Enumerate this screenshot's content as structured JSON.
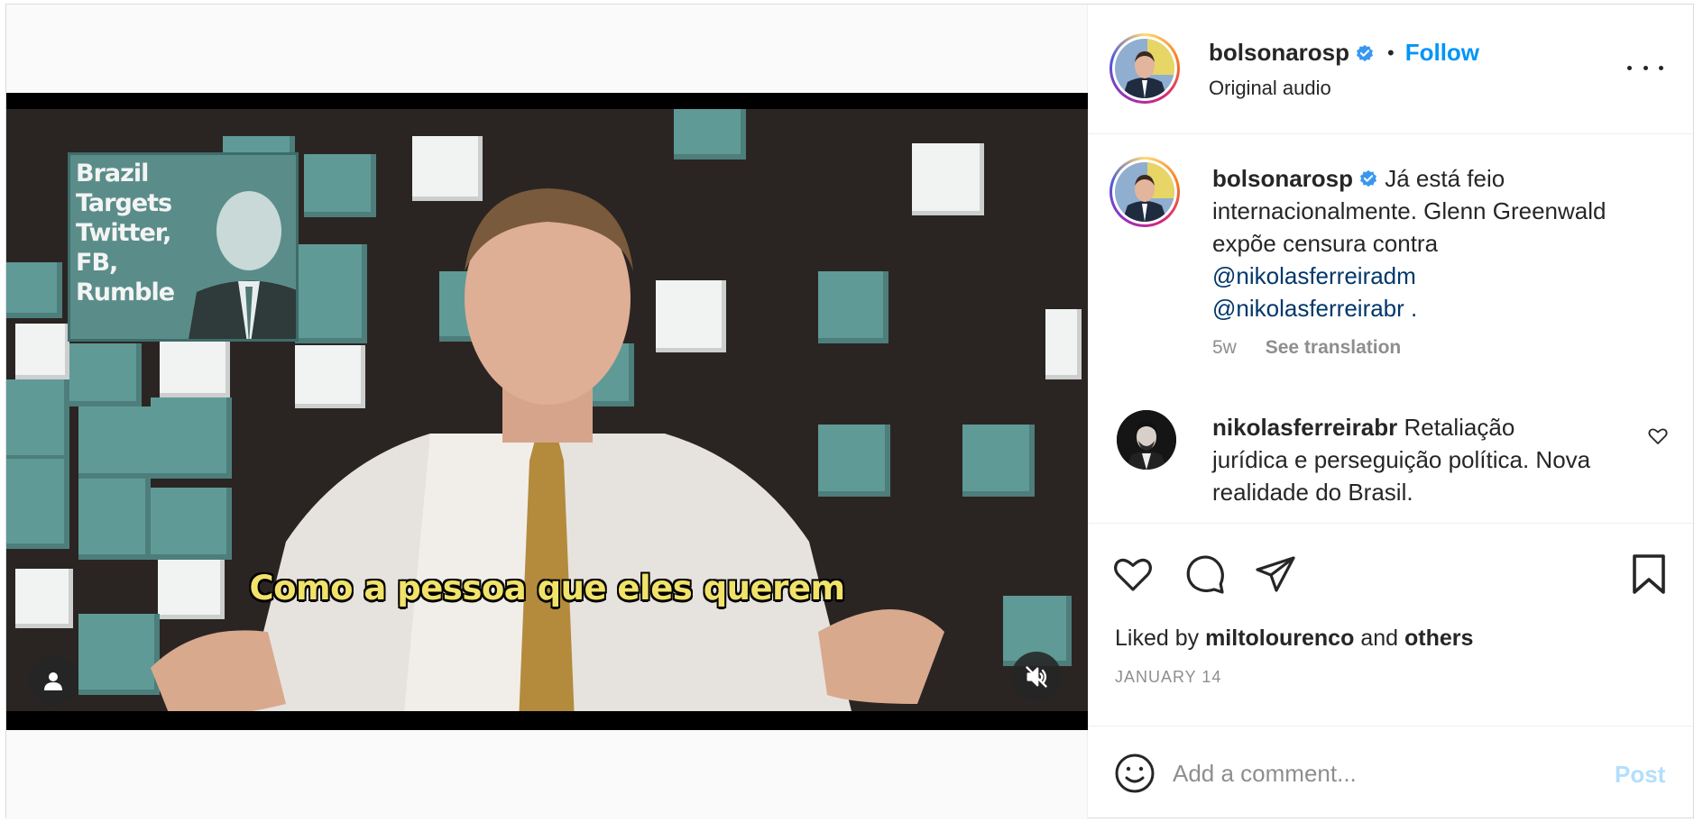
{
  "post": {
    "username": "bolsonarosp",
    "follow_label": "Follow",
    "audio_label": "Original audio",
    "separator": "•"
  },
  "video": {
    "inset_text": "Brazil Targets Twitter, FB, Rumble",
    "subtitle": "Como a pessoa que eles querem",
    "muted": true
  },
  "caption": {
    "username": "bolsonarosp",
    "text": "Já está feio internacionalmente. Glenn Greenwald expõe censura contra",
    "mention1": "@nikolasferreiradm",
    "mention2": "@nikolasferreirabr .",
    "age": "5w",
    "see_translation": "See translation"
  },
  "comments": [
    {
      "username": "nikolasferreirabr",
      "text": "Retaliação jurídica e perseguição política. Nova realidade do Brasil."
    }
  ],
  "likes": {
    "prefix": "Liked by",
    "user": "miltolourenco",
    "and": "and",
    "others": "others"
  },
  "date": "JANUARY 14",
  "add_comment": {
    "placeholder": "Add a comment...",
    "post_label": "Post"
  },
  "icons": {
    "verified": "verified-badge-icon",
    "more": "more-options-icon",
    "like": "heart-icon",
    "comment": "comment-icon",
    "share": "share-icon",
    "save": "bookmark-icon",
    "emoji": "emoji-icon",
    "mute": "speaker-muted-icon",
    "tagged": "user-icon"
  },
  "colors": {
    "accent": "#0095f6",
    "mention": "#00376b",
    "verified": "#3897f0",
    "post_disabled": "#b2dffc"
  }
}
